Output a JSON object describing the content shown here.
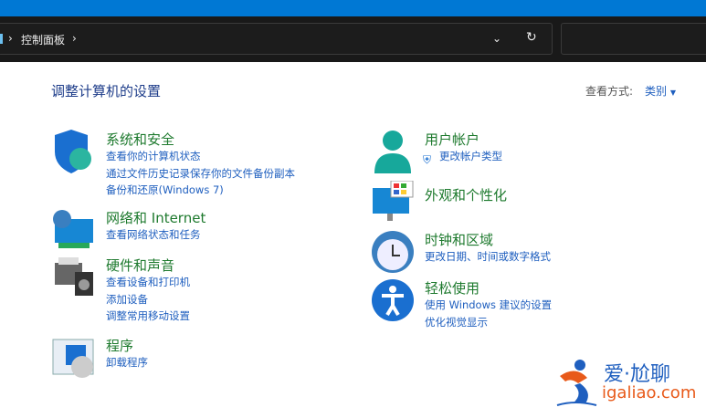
{
  "breadcrumb": {
    "items": [
      "控制面板"
    ]
  },
  "heading": "调整计算机的设置",
  "view_by": {
    "label": "查看方式:",
    "value": "类别"
  },
  "left": [
    {
      "title": "系统和安全",
      "icon": "shield-icon",
      "links": [
        "查看你的计算机状态",
        "通过文件历史记录保存你的文件备份副本",
        "备份和还原(Windows 7)"
      ]
    },
    {
      "title": "网络和 Internet",
      "icon": "network-globe-icon",
      "links": [
        "查看网络状态和任务"
      ]
    },
    {
      "title": "硬件和声音",
      "icon": "printer-speaker-icon",
      "links": [
        "查看设备和打印机",
        "添加设备",
        "调整常用移动设置"
      ]
    },
    {
      "title": "程序",
      "icon": "programs-disc-icon",
      "links": [
        "卸载程序"
      ]
    }
  ],
  "right": [
    {
      "title": "用户帐户",
      "icon": "user-icon",
      "links": [
        "更改帐户类型"
      ]
    },
    {
      "title": "外观和个性化",
      "icon": "monitor-palette-icon",
      "links": []
    },
    {
      "title": "时钟和区域",
      "icon": "clock-globe-icon",
      "links": [
        "更改日期、时间或数字格式"
      ]
    },
    {
      "title": "轻松使用",
      "icon": "accessibility-icon",
      "links": [
        "使用 Windows 建议的设置",
        "优化视觉显示"
      ]
    }
  ],
  "watermark": {
    "text": "爱·尬聊",
    "url_text": "igaliao.com"
  },
  "colors": {
    "accent": "#0078d4",
    "title": "#1e7a2e",
    "link": "#1f5fbf"
  }
}
